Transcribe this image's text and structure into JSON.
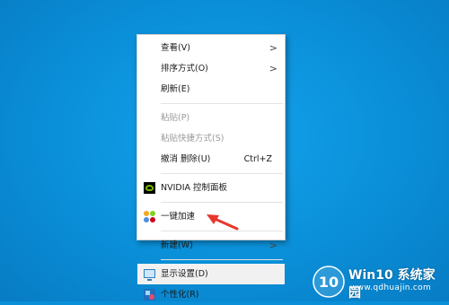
{
  "menu": {
    "items": [
      {
        "label": "查看(V)",
        "chevron": ">",
        "disabled": false
      },
      {
        "label": "排序方式(O)",
        "chevron": ">",
        "disabled": false
      },
      {
        "label": "刷新(E)",
        "disabled": false
      },
      {
        "label": "粘贴(P)",
        "disabled": true
      },
      {
        "label": "粘贴快捷方式(S)",
        "disabled": true
      },
      {
        "label": "撤消 删除(U)",
        "accelerator": "Ctrl+Z",
        "disabled": false
      },
      {
        "label": "NVIDIA 控制面板",
        "icon": "nvidia-icon"
      },
      {
        "label": "一键加速",
        "icon": "boost-icon"
      },
      {
        "label": "新建(W)",
        "chevron": ">",
        "disabled": false
      },
      {
        "label": "显示设置(D)",
        "icon": "display-settings-icon"
      },
      {
        "label": "个性化(R)",
        "icon": "personalize-icon"
      }
    ]
  },
  "watermark": {
    "logo_text": "10",
    "brand": "Win10 系统家园",
    "url": "www.qdhuajin.com"
  },
  "colors": {
    "desktop": "#0a8fd8",
    "arrow": "#e8372c"
  }
}
